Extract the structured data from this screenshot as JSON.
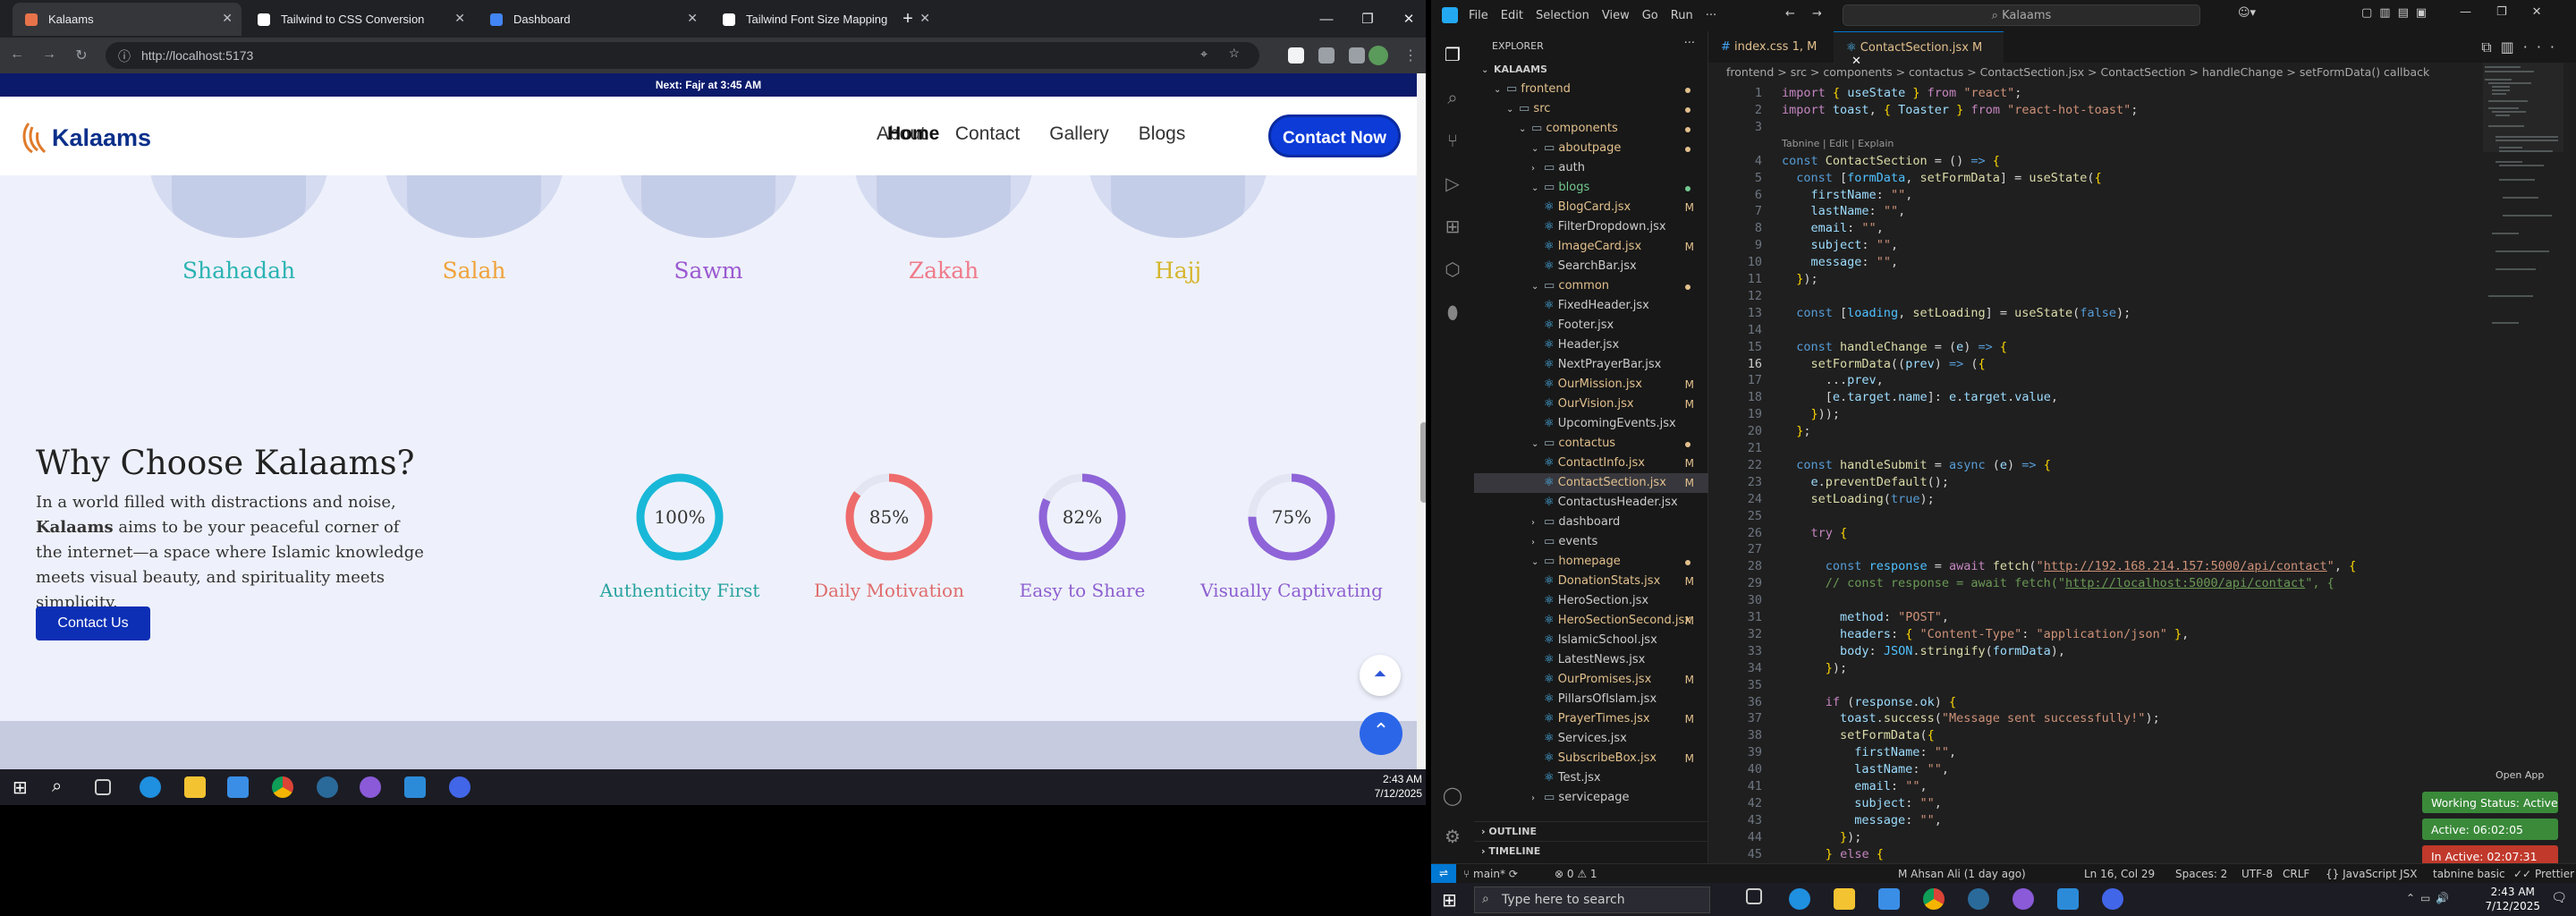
{
  "browser": {
    "tabs": [
      {
        "title": "Kalaams",
        "color": "#e8734a"
      },
      {
        "title": "Tailwind to CSS Conversion",
        "color": "#ffffff"
      },
      {
        "title": "Dashboard",
        "color": "#4285f4"
      },
      {
        "title": "Tailwind Font Size Mapping",
        "color": "#ffffff"
      }
    ],
    "url": "http://localhost:5173",
    "banner": "Next: Fajr at 3:45 AM"
  },
  "site": {
    "logo": "Kalaams",
    "nav": [
      "Home",
      "About",
      "Contact",
      "Gallery",
      "Blogs"
    ],
    "cta": "Contact Now",
    "pillars": [
      {
        "name": "Shahadah",
        "color": "#2bb3b3"
      },
      {
        "name": "Salah",
        "color": "#f0a23a"
      },
      {
        "name": "Sawm",
        "color": "#9b59d0"
      },
      {
        "name": "Zakah",
        "color": "#f07a8a"
      },
      {
        "name": "Hajj",
        "color": "#d6b52c"
      }
    ],
    "why": {
      "heading": "Why Choose Kalaams?",
      "p1": "In a world filled with distractions and noise,",
      "brand": "Kalaams",
      "p2": " aims to be your peaceful corner of the internet—a space where Islamic knowledge meets visual beauty, and spirituality meets simplicity.",
      "button": "Contact Us"
    },
    "stats": [
      {
        "value": 100,
        "label_value": "100%",
        "label": "Authenticity First",
        "color": "#19b8d8",
        "text_color": "#2aa3a0"
      },
      {
        "value": 85,
        "label_value": "85%",
        "label": "Daily Motivation",
        "color": "#ee6b6b",
        "text_color": "#e06b6b"
      },
      {
        "value": 82,
        "label_value": "82%",
        "label": "Easy to Share",
        "color": "#8e64d8",
        "text_color": "#8e5fd0"
      },
      {
        "value": 75,
        "label_value": "75%",
        "label": "Visually Captivating",
        "color": "#8e64d8",
        "text_color": "#8e5fd0"
      }
    ]
  },
  "taskbar_left": {
    "time": "2:43 AM",
    "date": "7/12/2025"
  },
  "vscode": {
    "menu": [
      "File",
      "Edit",
      "Selection",
      "View",
      "Go",
      "Run",
      "···"
    ],
    "search": "Kalaams",
    "explorer_title": "EXPLORER",
    "tree": [
      {
        "label": "KALAAMS",
        "indent": 0,
        "type": "root"
      },
      {
        "label": "frontend",
        "indent": 1,
        "type": "folder",
        "color": "#e2c08d",
        "dot": true
      },
      {
        "label": "src",
        "indent": 2,
        "type": "folder",
        "color": "#e2c08d",
        "dot": true
      },
      {
        "label": "components",
        "indent": 3,
        "type": "folder",
        "color": "#e2c08d",
        "dot": true
      },
      {
        "label": "aboutpage",
        "indent": 4,
        "type": "folder",
        "color": "#e2c08d",
        "dot": true
      },
      {
        "label": "auth",
        "indent": 4,
        "type": "folder-closed",
        "color": "#ccc"
      },
      {
        "label": "blogs",
        "indent": 4,
        "type": "folder",
        "color": "#73c991",
        "dot": true
      },
      {
        "label": "BlogCard.jsx",
        "indent": 5,
        "type": "file",
        "color": "#e2c08d",
        "badge": "M"
      },
      {
        "label": "FilterDropdown.jsx",
        "indent": 5,
        "type": "file",
        "color": "#ccc"
      },
      {
        "label": "ImageCard.jsx",
        "indent": 5,
        "type": "file",
        "color": "#e2c08d",
        "badge": "M"
      },
      {
        "label": "SearchBar.jsx",
        "indent": 5,
        "type": "file",
        "color": "#ccc"
      },
      {
        "label": "common",
        "indent": 4,
        "type": "folder",
        "color": "#e2c08d",
        "dot": true
      },
      {
        "label": "FixedHeader.jsx",
        "indent": 5,
        "type": "file",
        "color": "#ccc"
      },
      {
        "label": "Footer.jsx",
        "indent": 5,
        "type": "file",
        "color": "#ccc"
      },
      {
        "label": "Header.jsx",
        "indent": 5,
        "type": "file",
        "color": "#ccc"
      },
      {
        "label": "NextPrayerBar.jsx",
        "indent": 5,
        "type": "file",
        "color": "#ccc"
      },
      {
        "label": "OurMission.jsx",
        "indent": 5,
        "type": "file",
        "color": "#e2c08d",
        "badge": "M"
      },
      {
        "label": "OurVision.jsx",
        "indent": 5,
        "type": "file",
        "color": "#e2c08d",
        "badge": "M"
      },
      {
        "label": "UpcomingEvents.jsx",
        "indent": 5,
        "type": "file",
        "color": "#ccc"
      },
      {
        "label": "contactus",
        "indent": 4,
        "type": "folder",
        "color": "#e2c08d",
        "dot": true
      },
      {
        "label": "ContactInfo.jsx",
        "indent": 5,
        "type": "file",
        "color": "#e2c08d",
        "badge": "M"
      },
      {
        "label": "ContactSection.jsx",
        "indent": 5,
        "type": "file",
        "color": "#e2c08d",
        "badge": "M",
        "selected": true
      },
      {
        "label": "ContactusHeader.jsx",
        "indent": 5,
        "type": "file",
        "color": "#ccc"
      },
      {
        "label": "dashboard",
        "indent": 4,
        "type": "folder-closed",
        "color": "#ccc"
      },
      {
        "label": "events",
        "indent": 4,
        "type": "folder-closed",
        "color": "#ccc"
      },
      {
        "label": "homepage",
        "indent": 4,
        "type": "folder",
        "color": "#e2c08d",
        "dot": true
      },
      {
        "label": "DonationStats.jsx",
        "indent": 5,
        "type": "file",
        "color": "#e2c08d",
        "badge": "M"
      },
      {
        "label": "HeroSection.jsx",
        "indent": 5,
        "type": "file",
        "color": "#ccc"
      },
      {
        "label": "HeroSectionSecond.jsx",
        "indent": 5,
        "type": "file",
        "color": "#e2c08d",
        "badge": "M"
      },
      {
        "label": "IslamicSchool.jsx",
        "indent": 5,
        "type": "file",
        "color": "#ccc"
      },
      {
        "label": "LatestNews.jsx",
        "indent": 5,
        "type": "file",
        "color": "#ccc"
      },
      {
        "label": "OurPromises.jsx",
        "indent": 5,
        "type": "file",
        "color": "#e2c08d",
        "badge": "M"
      },
      {
        "label": "PillarsOfIslam.jsx",
        "indent": 5,
        "type": "file",
        "color": "#ccc"
      },
      {
        "label": "PrayerTimes.jsx",
        "indent": 5,
        "type": "file",
        "color": "#e2c08d",
        "badge": "M"
      },
      {
        "label": "Services.jsx",
        "indent": 5,
        "type": "file",
        "color": "#ccc"
      },
      {
        "label": "SubscribeBox.jsx",
        "indent": 5,
        "type": "file",
        "color": "#e2c08d",
        "badge": "M"
      },
      {
        "label": "Test.jsx",
        "indent": 5,
        "type": "file",
        "color": "#ccc"
      },
      {
        "label": "servicepage",
        "indent": 4,
        "type": "folder-closed",
        "color": "#ccc"
      }
    ],
    "outline": "OUTLINE",
    "timeline": "TIMELINE",
    "editor_tabs": [
      {
        "label": "index.css 1, M",
        "active": false
      },
      {
        "label": "ContactSection.jsx M",
        "active": true
      }
    ],
    "breadcrumb": "frontend > src > components > contactus > ContactSection.jsx > ContactSection > handleChange > setFormData() callback",
    "codelens": "Tabnine | Edit | Explain",
    "lines": [
      {
        "n": 1,
        "h": "<span class=\"kw\">import</span> <span class=\"p\">{</span> <span class=\"v\">useState</span> <span class=\"p\">}</span> <span class=\"kw\">from</span> <span class=\"s\">\"react\"</span>;"
      },
      {
        "n": 2,
        "h": "<span class=\"kw\">import</span> <span class=\"v\">toast</span>, <span class=\"p\">{</span> <span class=\"v\">Toaster</span> <span class=\"p\">}</span> <span class=\"kw\">from</span> <span class=\"s\">\"react-hot-toast\"</span>;"
      },
      {
        "n": 3,
        "h": ""
      },
      {
        "n": 4,
        "h": "<span class=\"k\">const</span> <span class=\"f\">ContactSection</span> = () <span class=\"k\">=&gt;</span> <span class=\"p\">{</span>"
      },
      {
        "n": 5,
        "h": "  <span class=\"k\">const</span> [<span class=\"cl\">formData</span>, <span class=\"f\">setFormData</span>] = <span class=\"f\">useState</span>(<span class=\"p\">{</span>"
      },
      {
        "n": 6,
        "h": "    <span class=\"v\">firstName</span>: <span class=\"s\">\"\"</span>,"
      },
      {
        "n": 7,
        "h": "    <span class=\"v\">lastName</span>: <span class=\"s\">\"\"</span>,"
      },
      {
        "n": 8,
        "h": "    <span class=\"v\">email</span>: <span class=\"s\">\"\"</span>,"
      },
      {
        "n": 9,
        "h": "    <span class=\"v\">subject</span>: <span class=\"s\">\"\"</span>,"
      },
      {
        "n": 10,
        "h": "    <span class=\"v\">message</span>: <span class=\"s\">\"\"</span>,"
      },
      {
        "n": 11,
        "h": "  <span class=\"p\">}</span>);"
      },
      {
        "n": 12,
        "h": ""
      },
      {
        "n": 13,
        "h": "  <span class=\"k\">const</span> [<span class=\"cl\">loading</span>, <span class=\"f\">setLoading</span>] = <span class=\"f\">useState</span>(<span class=\"k\">false</span>);"
      },
      {
        "n": 14,
        "h": ""
      },
      {
        "n": 15,
        "h": "  <span class=\"k\">const</span> <span class=\"f\">handleChange</span> = (<span class=\"v\">e</span>) <span class=\"k\">=&gt;</span> <span class=\"p\">{</span>"
      },
      {
        "n": 16,
        "h": "    <span class=\"f\">setFormData</span>((<span class=\"v\">prev</span>) <span class=\"k\">=&gt;</span> (<span class=\"p\">{</span>"
      },
      {
        "n": 17,
        "h": "      ...<span class=\"v\">prev</span>,"
      },
      {
        "n": 18,
        "h": "      [<span class=\"v\">e</span>.<span class=\"v\">target</span>.<span class=\"v\">name</span>]: <span class=\"v\">e</span>.<span class=\"v\">target</span>.<span class=\"v\">value</span>,"
      },
      {
        "n": 19,
        "h": "    <span class=\"p\">}</span>));"
      },
      {
        "n": 20,
        "h": "  <span class=\"p\">}</span>;"
      },
      {
        "n": 21,
        "h": ""
      },
      {
        "n": 22,
        "h": "  <span class=\"k\">const</span> <span class=\"f\">handleSubmit</span> = <span class=\"k\">async</span> (<span class=\"v\">e</span>) <span class=\"k\">=&gt;</span> <span class=\"p\">{</span>"
      },
      {
        "n": 23,
        "h": "    <span class=\"v\">e</span>.<span class=\"f\">preventDefault</span>();"
      },
      {
        "n": 24,
        "h": "    <span class=\"f\">setLoading</span>(<span class=\"k\">true</span>);"
      },
      {
        "n": 25,
        "h": ""
      },
      {
        "n": 26,
        "h": "    <span class=\"kw\">try</span> <span class=\"p\">{</span>"
      },
      {
        "n": 27,
        "h": ""
      },
      {
        "n": 28,
        "h": "      <span class=\"k\">const</span> <span class=\"cl\">response</span> = <span class=\"kw\">await</span> <span class=\"f\">fetch</span>(<span class=\"s\">\"<u>http://192.168.214.157:5000/api/contact</u>\"</span>, <span class=\"p\">{</span>"
      },
      {
        "n": 29,
        "h": "      <span class=\"c\">// const response = await fetch(\"<u>http://localhost:5000/api/contact</u>\", {</span>"
      },
      {
        "n": 30,
        "h": ""
      },
      {
        "n": 31,
        "h": "        <span class=\"v\">method</span>: <span class=\"s\">\"POST\"</span>,"
      },
      {
        "n": 32,
        "h": "        <span class=\"v\">headers</span>: <span class=\"p\">{</span> <span class=\"s\">\"Content-Type\"</span>: <span class=\"s\">\"application/json\"</span> <span class=\"p\">}</span>,"
      },
      {
        "n": 33,
        "h": "        <span class=\"v\">body</span>: <span class=\"cl\">JSON</span>.<span class=\"f\">stringify</span>(<span class=\"v\">formData</span>),"
      },
      {
        "n": 34,
        "h": "      <span class=\"p\">}</span>);"
      },
      {
        "n": 35,
        "h": ""
      },
      {
        "n": 36,
        "h": "      <span class=\"kw\">if</span> (<span class=\"v\">response</span>.<span class=\"v\">ok</span>) <span class=\"p\">{</span>"
      },
      {
        "n": 37,
        "h": "        <span class=\"v\">toast</span>.<span class=\"f\">success</span>(<span class=\"s\">\"Message sent successfully!\"</span>);"
      },
      {
        "n": 38,
        "h": "        <span class=\"f\">setFormData</span>(<span class=\"p\">{</span>"
      },
      {
        "n": 39,
        "h": "          <span class=\"v\">firstName</span>: <span class=\"s\">\"\"</span>,"
      },
      {
        "n": 40,
        "h": "          <span class=\"v\">lastName</span>: <span class=\"s\">\"\"</span>,"
      },
      {
        "n": 41,
        "h": "          <span class=\"v\">email</span>: <span class=\"s\">\"\"</span>,"
      },
      {
        "n": 42,
        "h": "          <span class=\"v\">subject</span>: <span class=\"s\">\"\"</span>,"
      },
      {
        "n": 43,
        "h": "          <span class=\"v\">message</span>: <span class=\"s\">\"\"</span>,"
      },
      {
        "n": 44,
        "h": "        <span class=\"p\">}</span>);"
      },
      {
        "n": 45,
        "h": "      <span class=\"p\">}</span> <span class=\"kw\">else</span> <span class=\"p\">{</span>"
      }
    ],
    "status": {
      "branch": "main*",
      "problems": "⊗ 0 ⚠ 1",
      "blame": "M Ahsan Ali (1 day ago)",
      "position": "Ln 16, Col 29",
      "spaces": "Spaces: 2",
      "encoding": "UTF-8",
      "eol": "CRLF",
      "language": "JavaScript JSX",
      "tabnine": "tabnine basic",
      "prettier": "Prettier"
    },
    "open_app": "Open App",
    "work_badges": [
      {
        "label": "Working Status: Active",
        "color": "#3a8a3a"
      },
      {
        "label": "Active: 06:02:05",
        "color": "#3a8a3a"
      },
      {
        "label": "In Active: 02:07:31",
        "color": "#c0392b"
      }
    ]
  },
  "taskbar_right": {
    "search_placeholder": "Type here to search",
    "time": "2:43 AM",
    "date": "7/12/2025"
  }
}
